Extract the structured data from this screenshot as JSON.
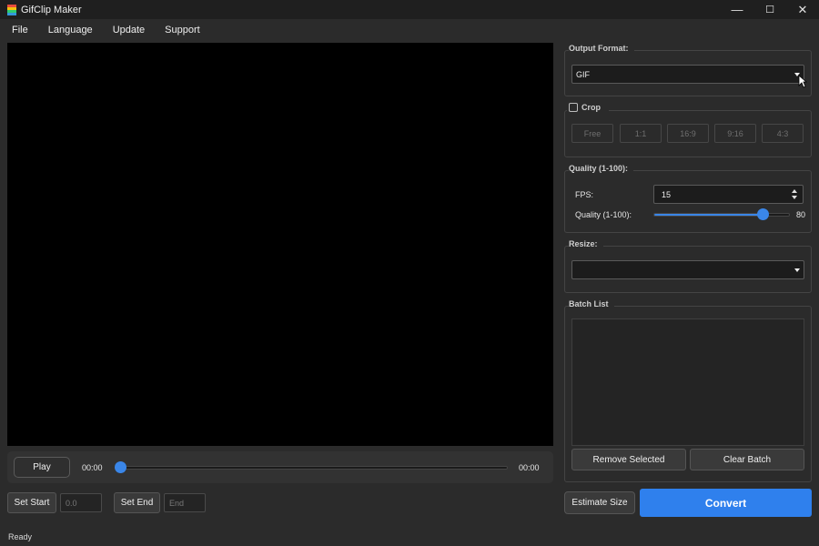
{
  "window": {
    "title": "GifClip Maker",
    "minimize": "—",
    "maximize": "☐",
    "close": "✕"
  },
  "menu": [
    "File",
    "Language",
    "Update",
    "Support"
  ],
  "player": {
    "play_label": "Play",
    "time_current": "00:00",
    "time_total": "00:00",
    "seek_position": 0
  },
  "trim": {
    "set_start_label": "Set Start",
    "start_placeholder": "0.0",
    "set_end_label": "Set End",
    "end_placeholder": "End"
  },
  "status": "Ready",
  "output_format": {
    "label": "Output Format:",
    "value": "GIF"
  },
  "crop": {
    "label": "Crop",
    "checked": false,
    "ratios": [
      "Free",
      "1:1",
      "16:9",
      "9:16",
      "4:3"
    ]
  },
  "quality_group": {
    "label": "Quality (1-100):",
    "fps_label": "FPS:",
    "fps_value": "15",
    "quality_label": "Quality (1-100):",
    "quality_value": "80",
    "quality_fraction": 0.8
  },
  "resize": {
    "label": "Resize:",
    "value": ""
  },
  "batch": {
    "label": "Batch List",
    "items": [],
    "remove_label": "Remove Selected",
    "clear_label": "Clear Batch"
  },
  "actions": {
    "estimate_label": "Estimate Size",
    "convert_label": "Convert"
  },
  "colors": {
    "accent": "#2f80ed",
    "slider": "#3a86e8",
    "video_bg": "#000000",
    "window_bg": "#2b2b2b"
  }
}
